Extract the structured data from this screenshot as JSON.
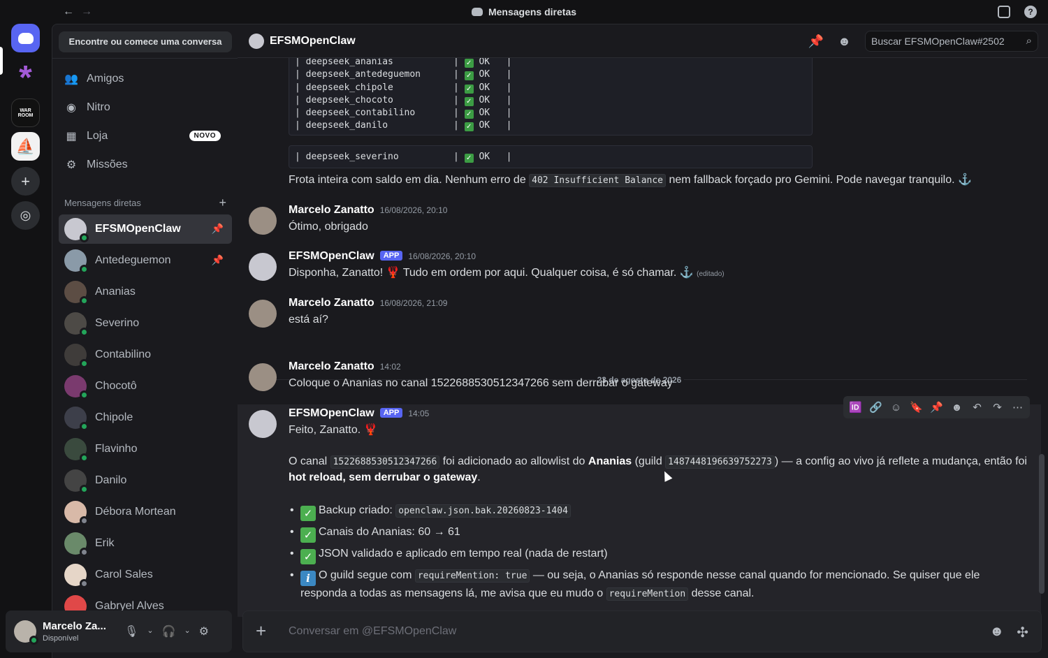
{
  "window": {
    "title": "Mensagens diretas"
  },
  "sidebar": {
    "search_label": "Encontre ou comece uma conversa",
    "nav": [
      {
        "label": "Amigos",
        "icon": "friends-icon"
      },
      {
        "label": "Nitro",
        "icon": "nitro-icon"
      },
      {
        "label": "Loja",
        "icon": "shop-icon",
        "badge": "NOVO"
      },
      {
        "label": "Missões",
        "icon": "quests-icon"
      }
    ],
    "dm_header": "Mensagens diretas",
    "dms": [
      {
        "name": "EFSMOpenClaw",
        "status": "online",
        "pinned": true,
        "active": true,
        "color": "#c8c8d0"
      },
      {
        "name": "Antedeguemon",
        "status": "online",
        "pinned": true,
        "color": "#8a9aa8"
      },
      {
        "name": "Ananias",
        "status": "online",
        "color": "#5c4d44"
      },
      {
        "name": "Severino",
        "status": "online",
        "color": "#4d4a46"
      },
      {
        "name": "Contabilino",
        "status": "online",
        "color": "#3f3c3a"
      },
      {
        "name": "Chocotô",
        "status": "online",
        "color": "#7a3a6e"
      },
      {
        "name": "Chipole",
        "status": "online",
        "color": "#3d3f4a"
      },
      {
        "name": "Flavinho",
        "status": "online",
        "color": "#3a4a3e"
      },
      {
        "name": "Danilo",
        "status": "online",
        "color": "#444444"
      },
      {
        "name": "Débora Mortean",
        "status": "offline",
        "color": "#d8b9a8"
      },
      {
        "name": "Erik",
        "status": "offline",
        "color": "#6a8a6a"
      },
      {
        "name": "Carol Sales",
        "status": "offline",
        "color": "#e6d6c8"
      },
      {
        "name": "Gabryel Alves",
        "status": "offline",
        "color": "#e04848"
      }
    ]
  },
  "user": {
    "name": "Marcelo Za...",
    "status": "Disponível"
  },
  "chat": {
    "channel_name": "EFSMOpenClaw",
    "search_placeholder": "Buscar EFSMOpenClaw#2502",
    "composer_placeholder": "Conversar em @EFSMOpenClaw",
    "code_rows_1": [
      "| deepseek_ananias           | ",
      "| deepseek_antedeguemon      | ",
      "| deepseek_chipole           | ",
      "| deepseek_chocoto           | ",
      "| deepseek_contabilino       | ",
      "| deepseek_danilo            | "
    ],
    "code_ok": " OK   |",
    "code_row_2": "| deepseek_severino          | ",
    "frota_pre": "Frota inteira com saldo em dia. Nenhum erro de ",
    "frota_code": "402 Insufficient Balance",
    "frota_post": " nem fallback forçado pro Gemini. Pode navegar tranquilo. ⚓",
    "date_divider": "23 de agosto de 2026",
    "messages": [
      {
        "author": "Marcelo Zanatto",
        "time": "16/08/2026, 20:10",
        "text": "Ótimo, obrigado"
      },
      {
        "author": "EFSMOpenClaw",
        "app": "APP",
        "time": "16/08/2026, 20:10",
        "text": "Disponha, Zanatto! 🦞 Tudo em ordem por aqui. Qualquer coisa, é só chamar. ⚓",
        "edited": "(editado)"
      },
      {
        "author": "Marcelo Zanatto",
        "time": "16/08/2026, 21:09",
        "text": "está aí?"
      },
      {
        "author": "Marcelo Zanatto",
        "time": "14:02",
        "text": "Coloque o Ananias no canal 1522688530512347266 sem derrubar o gateway"
      },
      {
        "author": "EFSMOpenClaw",
        "app": "APP",
        "time": "14:05",
        "text": "Feito, Zanatto. 🦞"
      }
    ],
    "final": {
      "p1_a": "O canal ",
      "p1_code1": "1522688530512347266",
      "p1_b": " foi adicionado ao allowlist do ",
      "p1_bold1": "Ananias",
      "p1_c": " (guild ",
      "p1_code2": "1487448196639752273",
      "p1_d": ") — a config ao vivo já reflete a mudança, então foi ",
      "p1_bold2": "hot reload, sem derrubar o gateway",
      "p1_e": ".",
      "b1": "Backup criado: ",
      "b1_code": "openclaw.json.bak.20260823-1404",
      "b2": "Canais do Ananias: 60 → 61",
      "b3": "JSON validado e aplicado em tempo real (nada de restart)",
      "b4_a": "O guild segue com ",
      "b4_code": "requireMention: true",
      "b4_b": " — ou seja, o Ananias só responde nesse canal quando for mencionado. Se quiser que ele responda a todas as mensagens lá, me avisa que eu mudo o ",
      "b4_code2": "requireMention",
      "b4_c": " desse canal."
    }
  },
  "colors": {
    "accent": "#5865f2",
    "online": "#23a55a",
    "offline": "#80848e"
  }
}
